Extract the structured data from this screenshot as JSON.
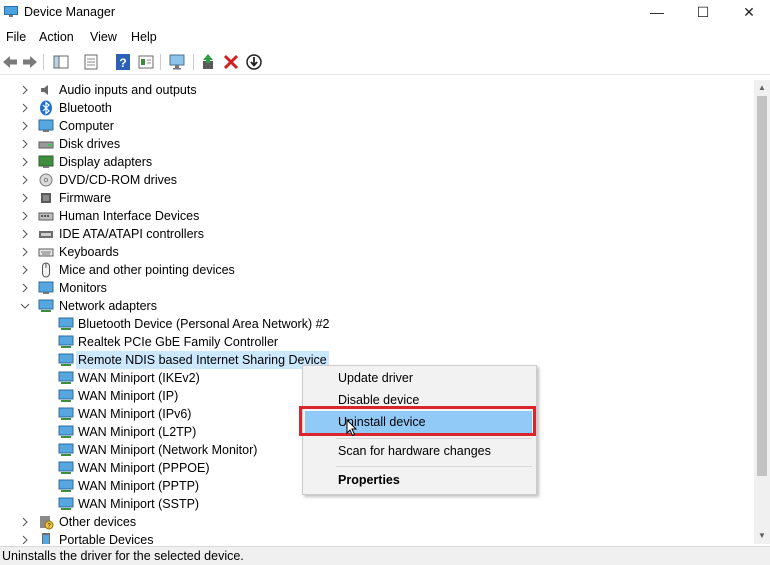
{
  "window": {
    "title": "Device Manager",
    "minimize": "—",
    "maximize": "☐",
    "close": "✕"
  },
  "menu": [
    "File",
    "Action",
    "View",
    "Help"
  ],
  "toolbar": {
    "icons": [
      "back-icon",
      "forward-icon",
      "show-hide-tree-icon",
      "properties-icon",
      "help-icon",
      "view-icon",
      "monitor-icon",
      "update-driver-icon",
      "uninstall-icon",
      "disable-icon"
    ]
  },
  "tree": {
    "categories": [
      {
        "label": "Audio inputs and outputs",
        "icon": "speaker-icon"
      },
      {
        "label": "Bluetooth",
        "icon": "bluetooth-icon"
      },
      {
        "label": "Computer",
        "icon": "computer-icon"
      },
      {
        "label": "Disk drives",
        "icon": "disk-icon"
      },
      {
        "label": "Display adapters",
        "icon": "display-icon"
      },
      {
        "label": "DVD/CD-ROM drives",
        "icon": "dvd-icon"
      },
      {
        "label": "Firmware",
        "icon": "firmware-icon"
      },
      {
        "label": "Human Interface Devices",
        "icon": "hid-icon"
      },
      {
        "label": "IDE ATA/ATAPI controllers",
        "icon": "ide-icon"
      },
      {
        "label": "Keyboards",
        "icon": "keyboard-icon"
      },
      {
        "label": "Mice and other pointing devices",
        "icon": "mouse-icon"
      },
      {
        "label": "Monitors",
        "icon": "monitor-icon"
      },
      {
        "label": "Network adapters",
        "icon": "network-icon",
        "expanded": true
      }
    ],
    "network_children": [
      "Bluetooth Device (Personal Area Network) #2",
      "Realtek PCIe GbE Family Controller",
      "Remote NDIS based Internet Sharing Device",
      "WAN Miniport (IKEv2)",
      "WAN Miniport (IP)",
      "WAN Miniport (IPv6)",
      "WAN Miniport (L2TP)",
      "WAN Miniport (Network Monitor)",
      "WAN Miniport (PPPOE)",
      "WAN Miniport (PPTP)",
      "WAN Miniport (SSTP)"
    ],
    "selected_child": "Remote NDIS based Internet Sharing Device",
    "after": [
      {
        "label": "Other devices",
        "icon": "other-devices-icon"
      },
      {
        "label": "Portable Devices",
        "icon": "portable-icon"
      }
    ]
  },
  "context_menu": {
    "items": [
      "Update driver",
      "Disable device",
      "Uninstall device",
      "Scan for hardware changes",
      "Properties"
    ],
    "highlighted": "Uninstall device"
  },
  "status": "Uninstalls the driver for the selected device.",
  "colors": {
    "selection": "#cce8ff",
    "menu_highlight": "#91c9f7",
    "annotation_red": "#d9252b"
  }
}
